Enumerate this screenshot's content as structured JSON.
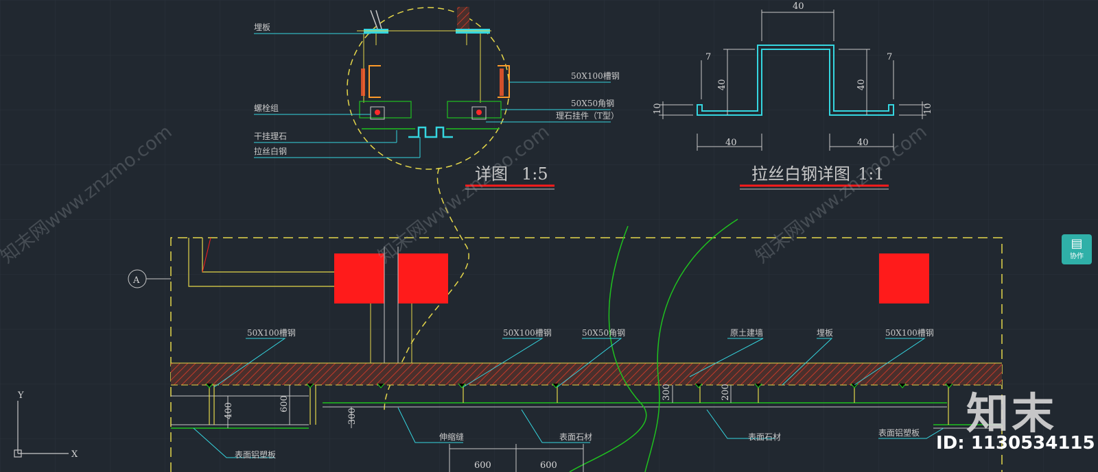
{
  "detail_1": {
    "title": "详图",
    "scale": "1:5",
    "labels": {
      "embedded_plate": "埋板",
      "bolt_group": "螺栓组",
      "dry_hang_marble": "干挂理石",
      "brushed_steel": "拉丝白钢",
      "channel_steel": "50X100槽钢",
      "angle_steel": "50X50角钢",
      "marble_hanger": "理石挂件（T型）"
    }
  },
  "detail_2": {
    "title": "拉丝白钢详图",
    "scale": "1:1",
    "dims": {
      "top": "40",
      "left_h": "40",
      "right_h": "40",
      "left_lip": "7",
      "right_lip": "7",
      "left_side": "10",
      "right_side": "10",
      "bottom_left": "40",
      "bottom_right": "40"
    }
  },
  "plan": {
    "axis_bubble": "A",
    "labels": {
      "channel_1": "50X100槽钢",
      "channel_2": "50X100槽钢",
      "angle": "50X50角钢",
      "concrete_wall": "原土建墙",
      "embedded_plate": "埋板",
      "channel_3": "50X100槽钢",
      "expansion_joint": "伸缩缝",
      "surface_stone_1": "表面石材",
      "surface_stone_2": "表面石材",
      "alu_panel_left": "表面铝塑板",
      "alu_panel_right": "表面铝塑板"
    },
    "dims": {
      "d400": "400",
      "d600": "600",
      "d300_left": "300",
      "d300_right": "300",
      "d200": "200",
      "bottom_1": "600",
      "bottom_2": "600"
    }
  },
  "ucs": {
    "y": "Y",
    "x": "X"
  },
  "watermark": "知末网www.znzmo.com",
  "collab_button": {
    "icon": "chat-icon",
    "label": "协作"
  },
  "brand": "知末",
  "image_id": "ID: 1130534115",
  "colors": {
    "background": "#212830",
    "cyan": "#35d6e0",
    "yellow": "#e6d84a",
    "red": "#ff1b1b",
    "green": "#1fc21f",
    "hatch": "#c43a2a"
  }
}
